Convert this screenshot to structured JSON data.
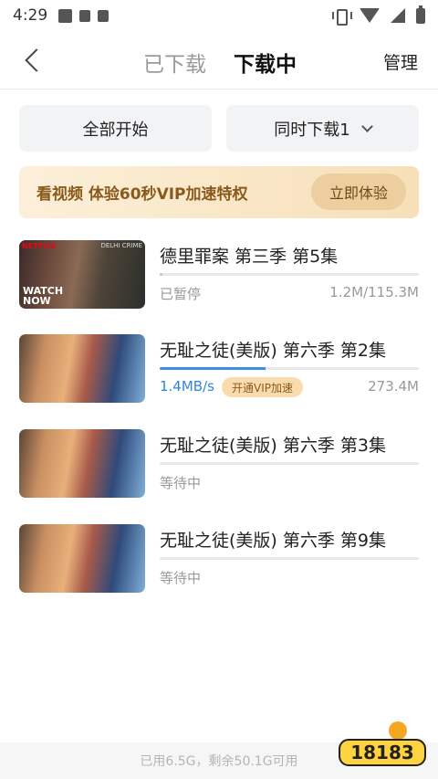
{
  "status_bar": {
    "time": "4:29"
  },
  "nav": {
    "tab_downloaded": "已下载",
    "tab_downloading": "下载中",
    "manage": "管理"
  },
  "actions": {
    "start_all": "全部开始",
    "concurrent": "同时下载1"
  },
  "vip_banner": {
    "text": "看视频 体验60秒VIP加速特权",
    "button": "立即体验"
  },
  "downloads": [
    {
      "title": "德里罪案 第三季 第5集",
      "status": "已暂停",
      "size": "1.2M/115.3M",
      "progress": 0.01,
      "thumb_tl": "NETFLIX",
      "thumb_tr": "DELHI CRIME",
      "thumb_bl": "WATCH NOW"
    },
    {
      "title": "无耻之徒(美版) 第六季 第2集",
      "status": "1.4MB/s",
      "accel": "开通VIP加速",
      "size": "273.4M",
      "progress": 0.41
    },
    {
      "title": "无耻之徒(美版) 第六季 第3集",
      "status": "等待中",
      "progress": 0
    },
    {
      "title": "无耻之徒(美版) 第六季 第9集",
      "status": "等待中",
      "progress": 0
    }
  ],
  "footer": {
    "storage": "已用6.5G，剩余50.1G可用"
  },
  "watermark": {
    "text": "18183"
  },
  "icons": [
    "back-icon",
    "chevron-down-icon",
    "vibrate-icon",
    "wifi-icon",
    "cell-signal-icon",
    "battery-icon"
  ],
  "colors": {
    "accent": "#3a8ee6",
    "vip_gold": "#8a5a1c",
    "vip_bg": "#fcefd9"
  }
}
